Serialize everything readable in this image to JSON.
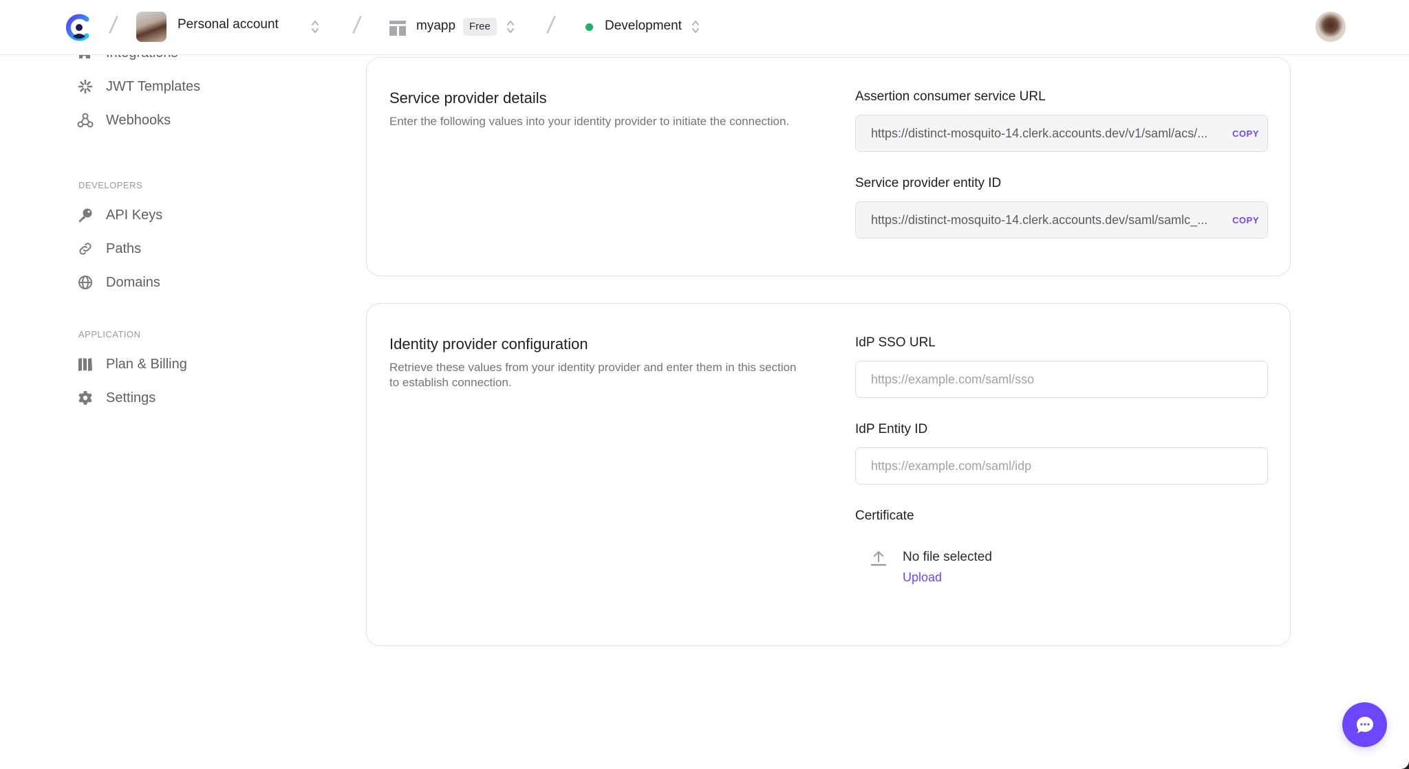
{
  "topbar": {
    "account": {
      "label": "Personal account"
    },
    "app": {
      "label": "myapp",
      "plan_badge": "Free"
    },
    "environment": {
      "label": "Development",
      "status_color": "#1fb061"
    },
    "separator": "/"
  },
  "sidebar": {
    "items_top": [
      {
        "label": "Integrations",
        "icon": "puzzle-icon"
      },
      {
        "label": "JWT Templates",
        "icon": "sparkle-icon"
      },
      {
        "label": "Webhooks",
        "icon": "webhook-icon"
      }
    ],
    "developers": {
      "heading": "DEVELOPERS",
      "items": [
        {
          "label": "API Keys",
          "icon": "key-icon"
        },
        {
          "label": "Paths",
          "icon": "link-icon"
        },
        {
          "label": "Domains",
          "icon": "globe-icon"
        }
      ]
    },
    "application": {
      "heading": "APPLICATION",
      "items": [
        {
          "label": "Plan & Billing",
          "icon": "billing-icon"
        },
        {
          "label": "Settings",
          "icon": "gear-icon"
        }
      ]
    }
  },
  "service_provider": {
    "title": "Service provider details",
    "description": "Enter the following values into your identity provider to initiate the connection.",
    "acs_url": {
      "label": "Assertion consumer service URL",
      "value": "https://distinct-mosquito-14.clerk.accounts.dev/v1/saml/acs/...",
      "copy_label": "COPY"
    },
    "entity_id": {
      "label": "Service provider entity ID",
      "value": "https://distinct-mosquito-14.clerk.accounts.dev/saml/samlc_...",
      "copy_label": "COPY"
    }
  },
  "identity_provider": {
    "title": "Identity provider configuration",
    "description": "Retrieve these values from your identity provider and enter them in this section to establish connection.",
    "sso_url": {
      "label": "IdP SSO URL",
      "value": "",
      "placeholder": "https://example.com/saml/sso"
    },
    "entity_id": {
      "label": "IdP Entity ID",
      "value": "",
      "placeholder": "https://example.com/saml/idp"
    },
    "certificate": {
      "label": "Certificate",
      "status": "No file selected",
      "upload_label": "Upload"
    }
  },
  "colors": {
    "accent": "#6c47ff",
    "status_green": "#1fb061"
  }
}
